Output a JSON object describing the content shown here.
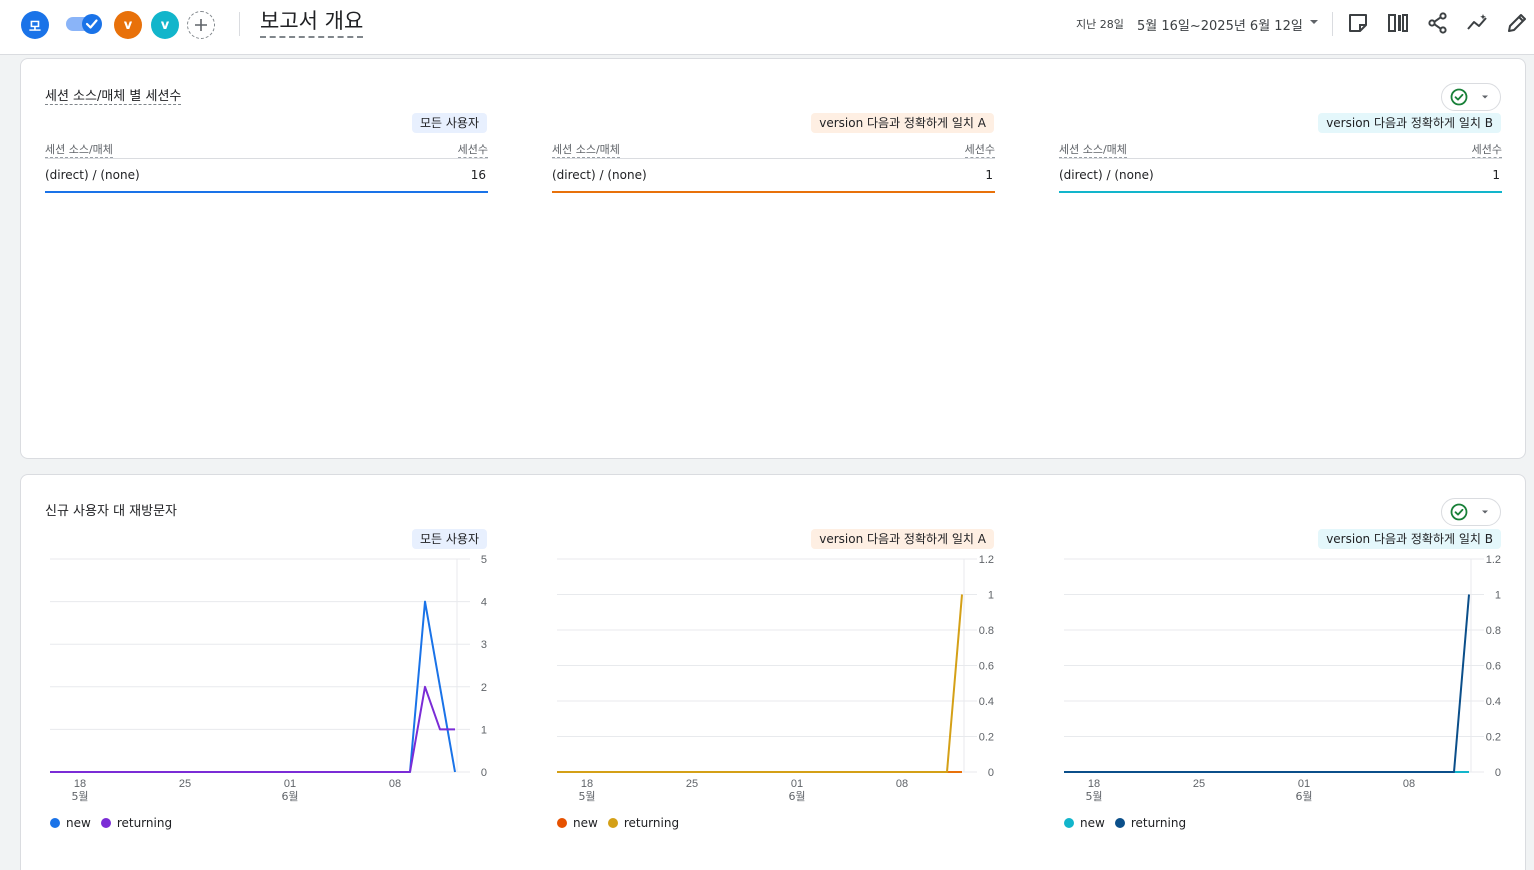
{
  "topbar": {
    "avatar_main": "모",
    "avatar_v1": "v",
    "avatar_v2": "v",
    "title": "보고서 개요",
    "range_label": "지난 28일",
    "range": "5월 16일~2025년 6월 12일",
    "icons": [
      "edit-note-icon",
      "compare-columns-icon",
      "share-icon",
      "insights-icon",
      "pencil-icon"
    ]
  },
  "colors": {
    "all_new": "#1a73e8",
    "all_returning": "#7b2cd6",
    "a_new": "#e8710a",
    "a_returning": "#d4a017",
    "a_new_dot": "#e65100",
    "b_new": "#12b5cb",
    "b_returning": "#0b4f8a",
    "accent_blue": "#1a73e8",
    "check_green": "#188038"
  },
  "sessions_card": {
    "title": "세션 소스/매체 별 세션수",
    "columns": [
      {
        "segment": "모든 사용자",
        "head_left": "세션 소스/매체",
        "head_right": "세션수",
        "row_label": "(direct) / (none)",
        "row_value": "16"
      },
      {
        "segment": "version 다음과 정확하게 일치 A",
        "head_left": "세션 소스/매체",
        "head_right": "세션수",
        "row_label": "(direct) / (none)",
        "row_value": "1"
      },
      {
        "segment": "version 다음과 정확하게 일치 B",
        "head_left": "세션 소스/매체",
        "head_right": "세션수",
        "row_label": "(direct) / (none)",
        "row_value": "1"
      }
    ]
  },
  "users_card": {
    "title": "신규 사용자 대 재방문자",
    "segments": [
      "모든 사용자",
      "version 다음과 정확하게 일치 A",
      "version 다음과 정확하게 일치 B"
    ],
    "legend": {
      "new": "new",
      "returning": "returning"
    }
  },
  "chart_data": [
    {
      "type": "line",
      "title": "모든 사용자",
      "x_ticks": [
        "18",
        "25",
        "01",
        "08"
      ],
      "x_month_labels": {
        "18": "5월",
        "01": "6월"
      },
      "x": [
        "05-16",
        "05-17",
        "05-18",
        "05-19",
        "05-20",
        "05-21",
        "05-22",
        "05-23",
        "05-24",
        "05-25",
        "05-26",
        "05-27",
        "05-28",
        "05-29",
        "05-30",
        "05-31",
        "06-01",
        "06-02",
        "06-03",
        "06-04",
        "06-05",
        "06-06",
        "06-07",
        "06-08",
        "06-09",
        "06-10",
        "06-11",
        "06-12"
      ],
      "ylim": [
        0,
        5
      ],
      "y_ticks": [
        "0",
        "1",
        "2",
        "3",
        "4",
        "5"
      ],
      "series": [
        {
          "name": "new",
          "values": [
            0,
            0,
            0,
            0,
            0,
            0,
            0,
            0,
            0,
            0,
            0,
            0,
            0,
            0,
            0,
            0,
            0,
            0,
            0,
            0,
            0,
            0,
            0,
            0,
            0,
            4,
            2,
            0
          ]
        },
        {
          "name": "returning",
          "values": [
            0,
            0,
            0,
            0,
            0,
            0,
            0,
            0,
            0,
            0,
            0,
            0,
            0,
            0,
            0,
            0,
            0,
            0,
            0,
            0,
            0,
            0,
            0,
            0,
            0,
            2,
            1,
            1
          ]
        }
      ]
    },
    {
      "type": "line",
      "title": "version 다음과 정확하게 일치 A",
      "x_ticks": [
        "18",
        "25",
        "01",
        "08"
      ],
      "x_month_labels": {
        "18": "5월",
        "01": "6월"
      },
      "x": [
        "05-16",
        "05-17",
        "05-18",
        "05-19",
        "05-20",
        "05-21",
        "05-22",
        "05-23",
        "05-24",
        "05-25",
        "05-26",
        "05-27",
        "05-28",
        "05-29",
        "05-30",
        "05-31",
        "06-01",
        "06-02",
        "06-03",
        "06-04",
        "06-05",
        "06-06",
        "06-07",
        "06-08",
        "06-09",
        "06-10",
        "06-11",
        "06-12"
      ],
      "ylim": [
        0,
        1.2
      ],
      "y_ticks": [
        "0",
        "0.2",
        "0.4",
        "0.6",
        "0.8",
        "1",
        "1.2"
      ],
      "series": [
        {
          "name": "new",
          "values": [
            0,
            0,
            0,
            0,
            0,
            0,
            0,
            0,
            0,
            0,
            0,
            0,
            0,
            0,
            0,
            0,
            0,
            0,
            0,
            0,
            0,
            0,
            0,
            0,
            0,
            0,
            0,
            0
          ]
        },
        {
          "name": "returning",
          "values": [
            0,
            0,
            0,
            0,
            0,
            0,
            0,
            0,
            0,
            0,
            0,
            0,
            0,
            0,
            0,
            0,
            0,
            0,
            0,
            0,
            0,
            0,
            0,
            0,
            0,
            0,
            0,
            1
          ]
        }
      ]
    },
    {
      "type": "line",
      "title": "version 다음과 정확하게 일치 B",
      "x_ticks": [
        "18",
        "25",
        "01",
        "08"
      ],
      "x_month_labels": {
        "18": "5월",
        "01": "6월"
      },
      "x": [
        "05-16",
        "05-17",
        "05-18",
        "05-19",
        "05-20",
        "05-21",
        "05-22",
        "05-23",
        "05-24",
        "05-25",
        "05-26",
        "05-27",
        "05-28",
        "05-29",
        "05-30",
        "05-31",
        "06-01",
        "06-02",
        "06-03",
        "06-04",
        "06-05",
        "06-06",
        "06-07",
        "06-08",
        "06-09",
        "06-10",
        "06-11",
        "06-12"
      ],
      "ylim": [
        0,
        1.2
      ],
      "y_ticks": [
        "0",
        "0.2",
        "0.4",
        "0.6",
        "0.8",
        "1",
        "1.2"
      ],
      "series": [
        {
          "name": "new",
          "values": [
            0,
            0,
            0,
            0,
            0,
            0,
            0,
            0,
            0,
            0,
            0,
            0,
            0,
            0,
            0,
            0,
            0,
            0,
            0,
            0,
            0,
            0,
            0,
            0,
            0,
            0,
            0,
            0
          ]
        },
        {
          "name": "returning",
          "values": [
            0,
            0,
            0,
            0,
            0,
            0,
            0,
            0,
            0,
            0,
            0,
            0,
            0,
            0,
            0,
            0,
            0,
            0,
            0,
            0,
            0,
            0,
            0,
            0,
            0,
            0,
            0,
            1
          ]
        }
      ]
    }
  ]
}
